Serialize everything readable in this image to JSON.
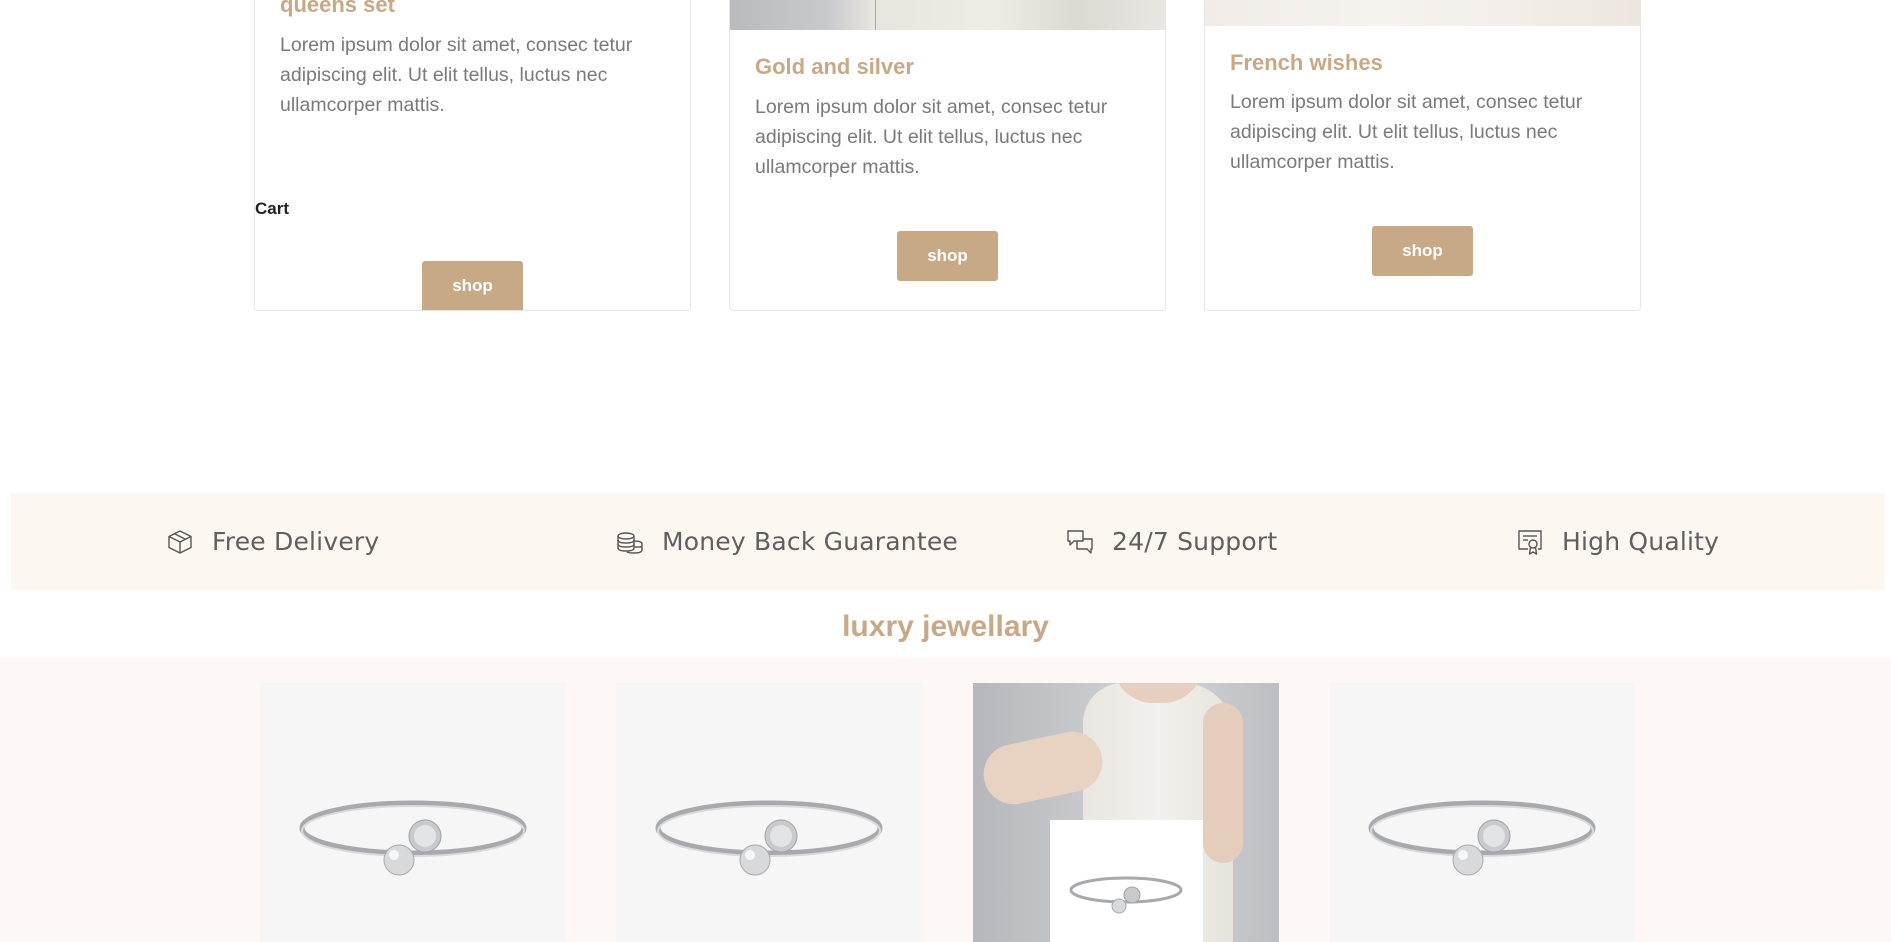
{
  "cards": [
    {
      "title": "queens set",
      "text": "Lorem ipsum dolor sit amet, consec tetur adipiscing elit. Ut elit tellus, luctus nec ullamcorper mattis.",
      "button": "shop"
    },
    {
      "title": "Gold and silver",
      "text": "Lorem ipsum dolor sit amet, consec tetur adipiscing elit. Ut elit tellus, luctus nec ullamcorper mattis.",
      "button": "shop"
    },
    {
      "title": "French wishes",
      "text": "Lorem ipsum dolor sit amet, consec tetur adipiscing elit. Ut elit tellus, luctus nec ullamcorper mattis.",
      "button": "shop"
    }
  ],
  "cart_label": "Cart",
  "features": [
    {
      "label": "Free Delivery",
      "icon": "box-icon"
    },
    {
      "label": "Money Back Guarantee",
      "icon": "coins-icon"
    },
    {
      "label": "24/7 Support",
      "icon": "chat-icon"
    },
    {
      "label": "High Quality",
      "icon": "certificate-icon"
    }
  ],
  "luxury_section": {
    "title": "luxry jewellary"
  },
  "colors": {
    "accent": "#c9a985",
    "button": "#c7a986",
    "features_bg": "#fcf7f1",
    "products_bg": "#fdf8f5"
  }
}
